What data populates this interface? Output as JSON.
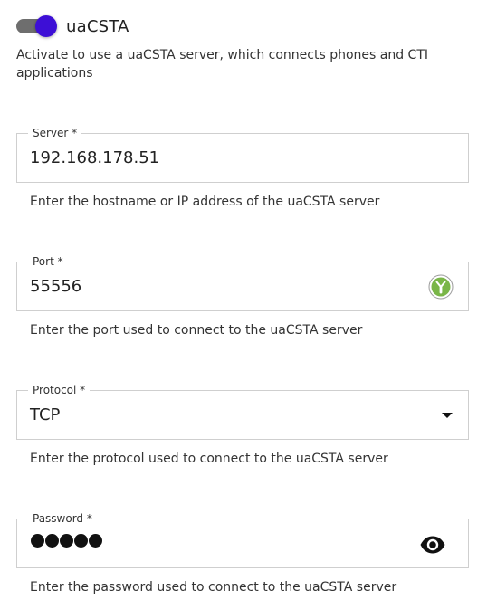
{
  "toggle": {
    "label": "uaCSTA",
    "checked": true,
    "description": "Activate to use a uaCSTA server, which connects phones and CTI applications"
  },
  "fields": {
    "server": {
      "label": "Server *",
      "value": "192.168.178.51",
      "helper": "Enter the hostname or IP address of the uaCSTA server"
    },
    "port": {
      "label": "Port *",
      "value": "55556",
      "helper": "Enter the port used to connect to the uaCSTA server",
      "icon": "grammar-assistant-icon"
    },
    "protocol": {
      "label": "Protocol *",
      "value": "TCP",
      "helper": "Enter the protocol used to connect to the uaCSTA server",
      "icon": "dropdown-arrow-icon"
    },
    "password": {
      "label": "Password *",
      "masked_length": 5,
      "helper": "Enter the password used to connect to the uaCSTA server",
      "icon": "eye-icon"
    }
  },
  "colors": {
    "accent": "#3d0fd6",
    "track": "#6e6e6e",
    "border": "#cfcfcf",
    "text": "#222222",
    "icon_green": "#7ab648"
  }
}
